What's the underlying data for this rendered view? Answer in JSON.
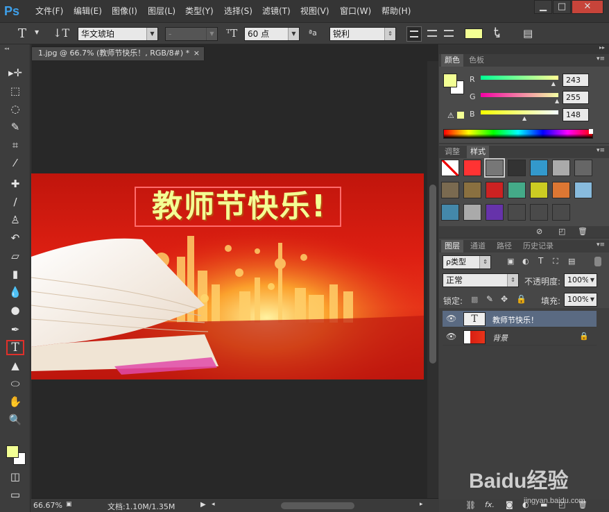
{
  "app": {
    "logo": "Ps",
    "menus": [
      "文件(F)",
      "编辑(E)",
      "图像(I)",
      "图层(L)",
      "类型(Y)",
      "选择(S)",
      "滤镜(T)",
      "视图(V)",
      "窗口(W)",
      "帮助(H)"
    ],
    "window_buttons": [
      "▁",
      "□",
      "✕"
    ]
  },
  "options": {
    "font_family": "华文琥珀",
    "font_style": "-",
    "font_size": "60 点",
    "aa_label": "ªa",
    "antialias": "锐利",
    "text_color": "#f3ff94"
  },
  "document": {
    "tab_title": "1.jpg @ 66.7% (教师节快乐！, RGB/8#) *",
    "tab_close": "×",
    "image_text": "教师节快乐!"
  },
  "status": {
    "zoom": "66.67%",
    "doc_info": "文档:1.10M/1.35M"
  },
  "color_panel": {
    "tabs": [
      "颜色",
      "色板"
    ],
    "r_label": "R",
    "g_label": "G",
    "b_label": "B",
    "r": "243",
    "g": "255",
    "b": "148",
    "fg_color": "#f3ff94",
    "r_fraction": 0.953,
    "g_fraction": 1.0,
    "b_fraction": 0.58
  },
  "styles_panel": {
    "tabs": [
      "调整",
      "样式"
    ]
  },
  "layers_panel": {
    "tabs": [
      "图层",
      "通道",
      "路径",
      "历史记录"
    ],
    "filter": "ρ类型",
    "blend": "正常",
    "opacity_label": "不透明度:",
    "opacity": "100%",
    "lock_label": "锁定:",
    "fill_label": "填充:",
    "fill": "100%",
    "layers": [
      {
        "name": "教师节快乐！",
        "thumb": "T",
        "selected": true
      },
      {
        "name": "背景",
        "thumb": "",
        "selected": false
      }
    ],
    "footer_icons": [
      "link-icon",
      "fx-icon",
      "mask-icon",
      "adjustment-icon",
      "folder-icon",
      "new-layer-icon",
      "trash-icon"
    ],
    "fx_label": "fx."
  },
  "tools": [
    {
      "name": "move-tool",
      "glyph": "▸✛"
    },
    {
      "name": "marquee-tool",
      "glyph": "⬚"
    },
    {
      "name": "lasso-tool",
      "glyph": "◌"
    },
    {
      "name": "quick-select-tool",
      "glyph": "✎"
    },
    {
      "name": "crop-tool",
      "glyph": "⌗"
    },
    {
      "name": "eyedropper-tool",
      "glyph": "⁄"
    },
    {
      "name": "healing-tool",
      "glyph": "✚"
    },
    {
      "name": "brush-tool",
      "glyph": "∕"
    },
    {
      "name": "stamp-tool",
      "glyph": "♙"
    },
    {
      "name": "history-brush-tool",
      "glyph": "↶"
    },
    {
      "name": "eraser-tool",
      "glyph": "▱"
    },
    {
      "name": "gradient-tool",
      "glyph": "▮"
    },
    {
      "name": "blur-tool",
      "glyph": "💧"
    },
    {
      "name": "dodge-tool",
      "glyph": "●"
    },
    {
      "name": "pen-tool",
      "glyph": "✒"
    },
    {
      "name": "type-tool",
      "glyph": "T"
    },
    {
      "name": "path-select-tool",
      "glyph": "▲"
    },
    {
      "name": "ellipse-tool",
      "glyph": "⬭"
    },
    {
      "name": "hand-tool",
      "glyph": "✋"
    },
    {
      "name": "zoom-tool",
      "glyph": "🔍"
    }
  ],
  "watermark": "Baidu经验",
  "watermark_url": "jingyan.baidu.com"
}
